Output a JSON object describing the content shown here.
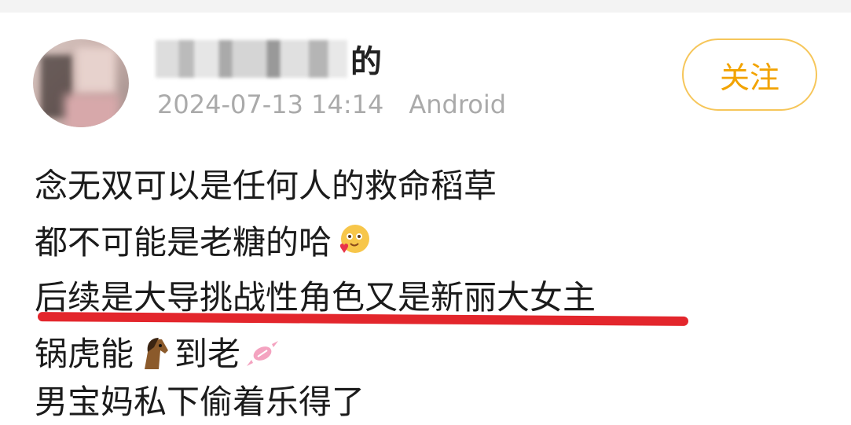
{
  "post": {
    "author_suffix": "的",
    "timestamp": "2024-07-13 14:14",
    "device": "Android",
    "follow_label": "关注",
    "lines": [
      "念无双可以是任何人的救命稻草",
      "都不可能是老糖的哈",
      "后续是大导挑战性角色又是新丽大女主",
      "锅虎能",
      "到老",
      "男宝妈私下偷着乐得了"
    ],
    "emojis": [
      "grinning-heart-face-icon",
      "horse-icon",
      "candy-icon"
    ],
    "highlight_color": "#e3262c",
    "accent_color": "#f2a300"
  }
}
